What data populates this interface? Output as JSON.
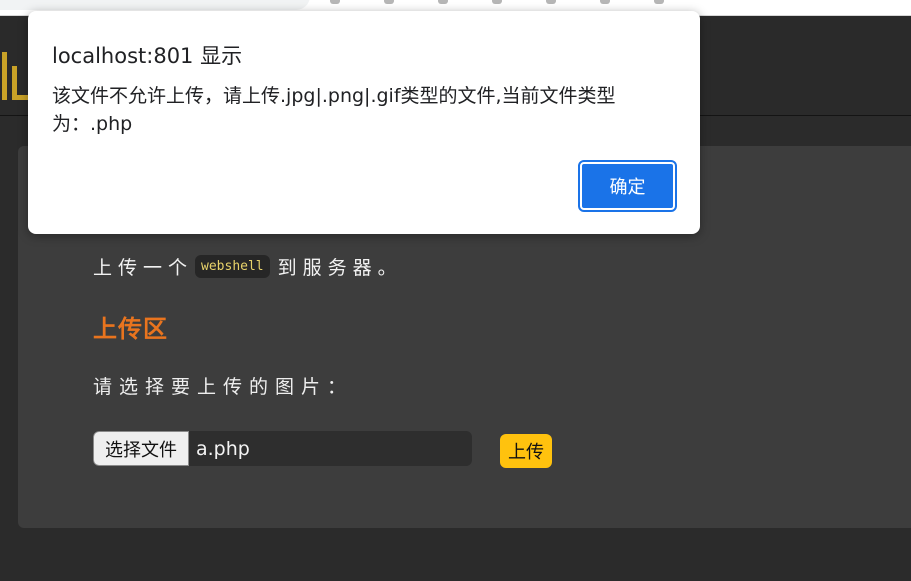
{
  "dialog": {
    "title": "localhost:801 显示",
    "message": "该文件不允许上传，请上传.jpg|.png|.gif类型的文件,当前文件类型为：.php",
    "ok_label": "确定"
  },
  "intro": {
    "before": "上传一个",
    "code": "webshell",
    "after": "到服务器。"
  },
  "upload_section": {
    "title": "上传区",
    "prompt": "请选择要上传的图片：",
    "choose_file_label": "选择文件",
    "selected_file": "a.php",
    "upload_label": "上传"
  },
  "colors": {
    "page_background": "#2b2b2b",
    "panel_background": "#3d3d3d",
    "section_title": "#e9741e",
    "upload_button": "#ffc20e",
    "dialog_button": "#1a73e8",
    "logo": "#c9a227"
  },
  "icons": {
    "logo": "logo-icon"
  }
}
